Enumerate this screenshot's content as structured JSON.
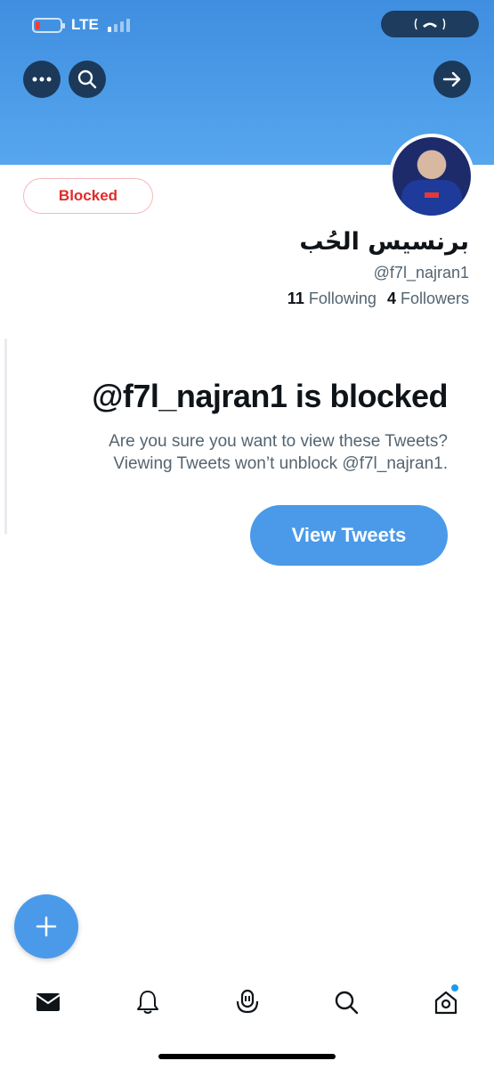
{
  "status_bar": {
    "network": "LTE"
  },
  "header": {
    "more_icon": "more-dots-icon",
    "search_icon": "search-icon",
    "forward_icon": "arrow-right-icon",
    "banner_color": "#4a9ae9"
  },
  "profile": {
    "blocked_label": "Blocked",
    "display_name": "برنسيس الحُب",
    "handle": "@f7l_najran1",
    "following_count": "11",
    "following_label": "Following",
    "followers_count": "4",
    "followers_label": "Followers"
  },
  "blocked_notice": {
    "title": "@f7l_najran1 is blocked",
    "line1": "Are you sure you want to view these Tweets?",
    "line2": "Viewing Tweets won’t unblock @f7l_najran1.",
    "button_label": "View Tweets"
  },
  "tabbar": {
    "items": [
      "mail-icon",
      "bell-icon",
      "spaces-icon",
      "search-icon",
      "home-icon"
    ]
  },
  "colors": {
    "accent": "#4a9ae9",
    "blocked_red": "#e02a2a"
  }
}
